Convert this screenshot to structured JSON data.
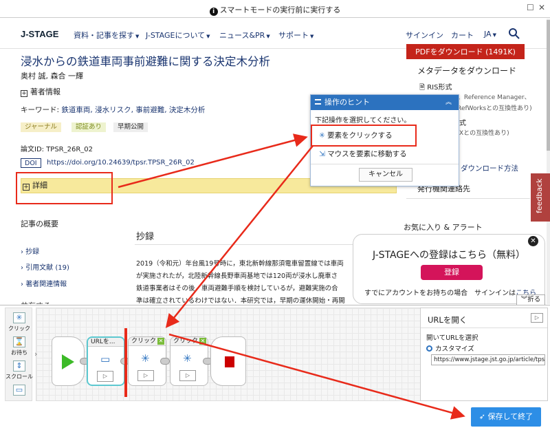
{
  "topbar": {
    "message": "スマートモードの実行前に実行する"
  },
  "header": {
    "logo": "J-STAGE",
    "nav": [
      "資料・記事を探す",
      "J-STAGEについて",
      "ニュース&PR",
      "サポート"
    ],
    "right": [
      "サインイン",
      "カート",
      "JA"
    ]
  },
  "article": {
    "title": "浸水からの鉄道車両事前避難に関する決定木分析",
    "authors": "奥村 誠, 森合 一輝",
    "author_info": "著者情報",
    "keywords_label": "キーワード:",
    "keywords": "鉄道車両, 浸水リスク, 事前避難, 決定木分析",
    "tags": [
      "ジャーナル",
      "認証あり",
      "早期公開"
    ],
    "doc_id": "論文ID: TPSR_26R_02",
    "doi_label": "DOI",
    "doi_url": "https://doi.org/10.24639/tpsr.TPSR_26R_02",
    "detail": "詳細",
    "summary_title": "記事の概要",
    "side_links": [
      "抄録",
      "引用文献 (19)",
      "著者関連情報"
    ],
    "side_cut": "共有する",
    "abstract_heading": "抄録",
    "abstract_lines": [
      "2019（令和元）年台風19号時に，東北新幹線那須電車留置線では車両",
      "が実施されたが，北陸新幹線長野車両基地では120両が浸水し廃車さ",
      "鉄道事業者はその後，車両避難手順を検討しているが，避難実施の合",
      "準は確立されているわけではない．本研究では，早期の運休開始・再開"
    ]
  },
  "right_col": {
    "pdf": "PDFをダウンロード (1491K)",
    "meta_dl": "メタデータをダウンロード",
    "ris": "RIS形式",
    "ris_note": "(EndNote、Reference Manager、",
    "ris_note2": "ProCite、RefWorksとの互換性あり)",
    "bib_cut": "式",
    "bib_note": "Xとの互換性あり)",
    "dl_method": "ダウンロード方法",
    "contact": "発行機関連絡先",
    "favs": "お気に入り & アラート",
    "feedback": "feedback"
  },
  "hint": {
    "title": "操作のヒント",
    "subtitle": "下記操作を選択してください。",
    "opt_click": "要素をクリックする",
    "opt_hover": "マウスを要素に移動する",
    "cancel": "キャンセル"
  },
  "register": {
    "title": "J-STAGEへの登録はこちら（無料）",
    "button": "登録",
    "text": "すでにアカウントをお持ちの場合",
    "signin": "サインインは",
    "link": "こちら",
    "fold": "折る"
  },
  "workflow": {
    "tools": [
      "クリック",
      "お待ち",
      "スクロール"
    ],
    "nodes": [
      {
        "label": "URLを..."
      },
      {
        "label": "クリック"
      },
      {
        "label": "クリック"
      }
    ]
  },
  "props": {
    "title": "URLを開く",
    "select_label": "開いてURLを選択",
    "radio": "カスタマイズ",
    "url": "https://www.jstage.jst.go.jp/article/tpsr/"
  },
  "save": {
    "label": "保存して終了"
  }
}
